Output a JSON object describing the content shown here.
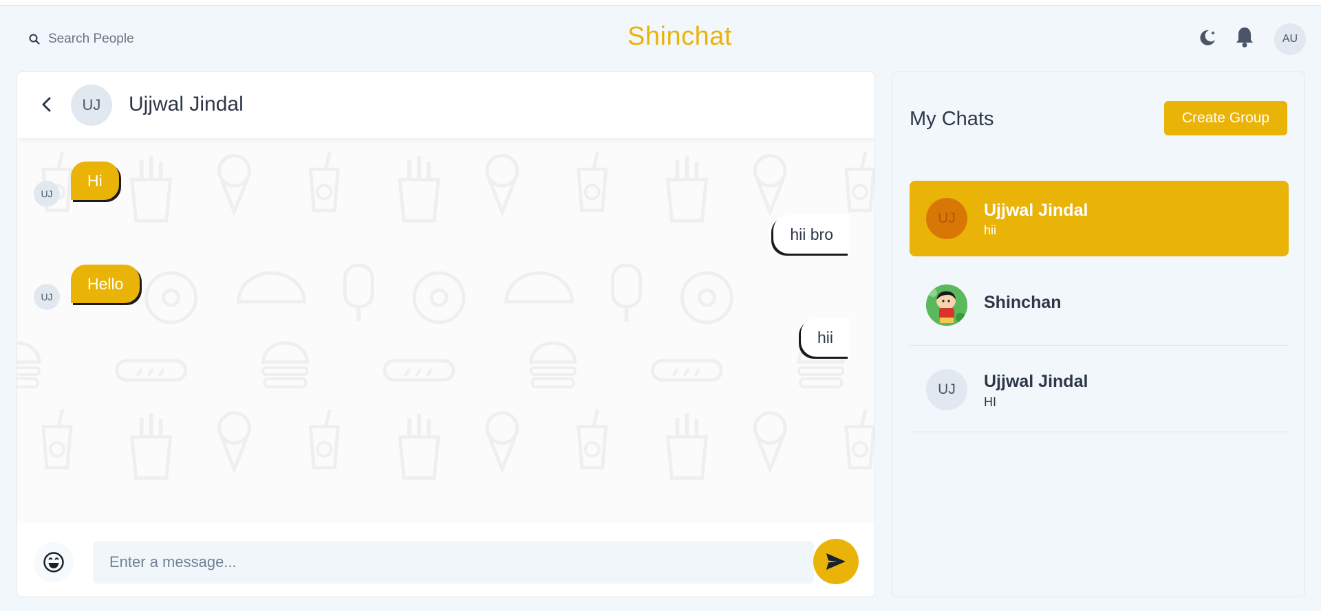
{
  "header": {
    "search_placeholder": "Search People",
    "brand": "Shinchat",
    "user_initials": "AU"
  },
  "chat": {
    "title": "Ujjwal Jindal",
    "avatar_initials": "UJ",
    "messages": [
      {
        "side": "in",
        "text": "Hi",
        "avatar": "UJ"
      },
      {
        "side": "out",
        "text": "hii bro"
      },
      {
        "side": "in",
        "text": "Hello",
        "avatar": "UJ"
      },
      {
        "side": "out",
        "text": "hii"
      }
    ],
    "input_placeholder": "Enter a message..."
  },
  "my_chats": {
    "title": "My Chats",
    "create_group_label": "Create Group",
    "items": [
      {
        "name": "Ujjwal Jindal",
        "last": "hii",
        "initials": "UJ",
        "active": true
      },
      {
        "name": "Shinchan",
        "last": "",
        "avatar": "shinchan-avatar"
      },
      {
        "name": "Ujjwal Jindal",
        "last": "HI",
        "initials": "UJ"
      }
    ]
  },
  "colors": {
    "accent": "#eab308",
    "background": "#f1f7fb",
    "avatar_bg": "#e2e8f0"
  },
  "icons": [
    "search-icon",
    "moon-icon",
    "bell-icon",
    "back-arrow-icon",
    "emoji-icon",
    "send-icon"
  ]
}
